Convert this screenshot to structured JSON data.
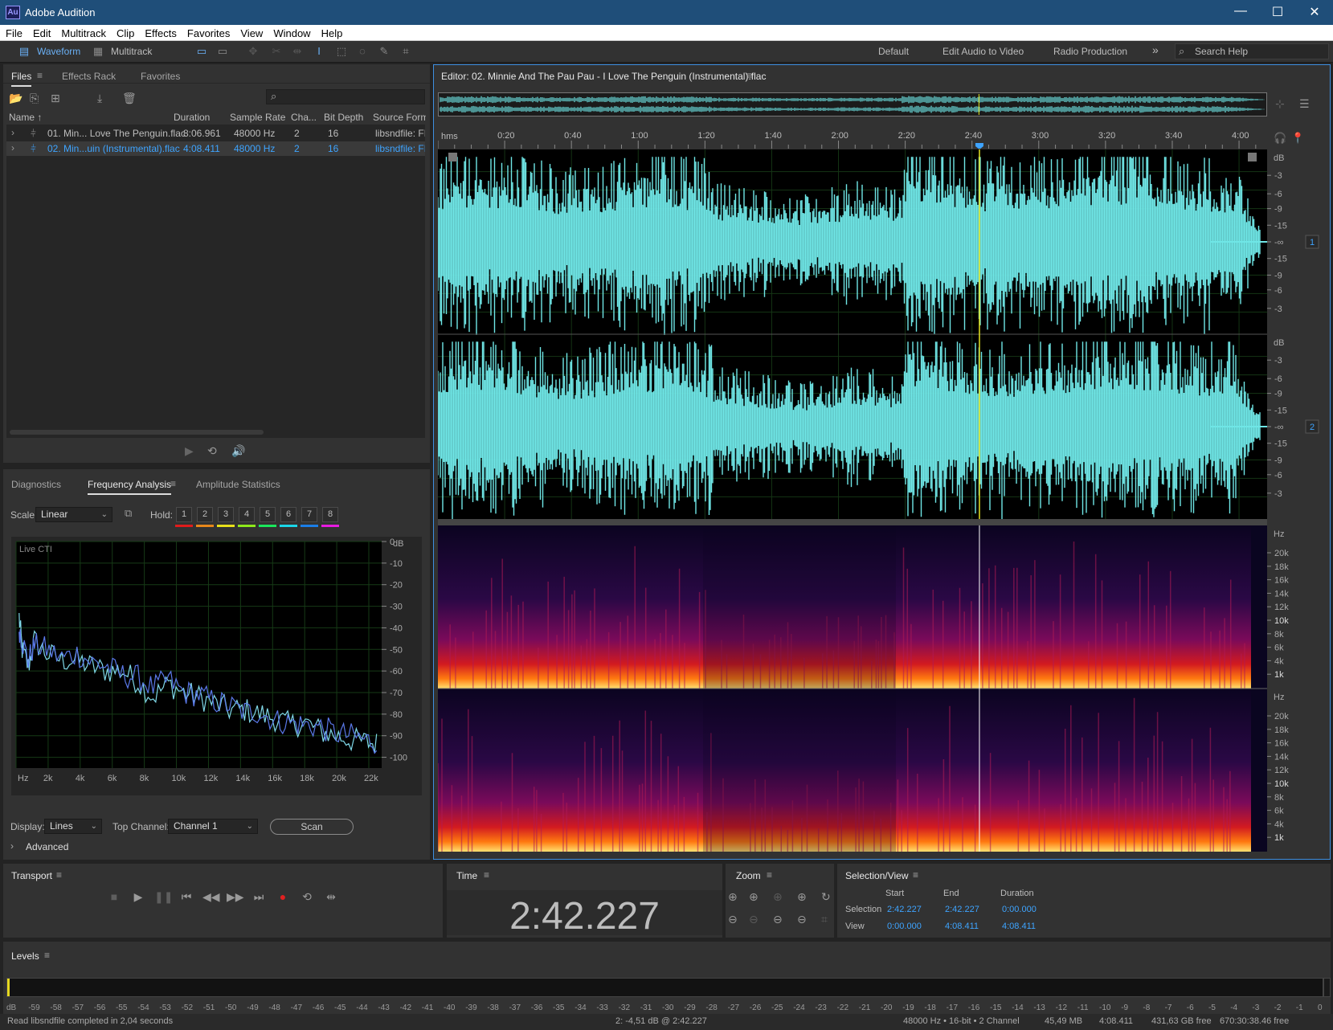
{
  "window": {
    "title": "Adobe Audition",
    "logo": "Au",
    "minimize": "—",
    "maximize": "☐",
    "close": "✕"
  },
  "menu": [
    "File",
    "Edit",
    "Multitrack",
    "Clip",
    "Effects",
    "Favorites",
    "View",
    "Window",
    "Help"
  ],
  "toolbar": {
    "waveform": "Waveform",
    "multitrack": "Multitrack",
    "workspaces": [
      "Default",
      "Edit Audio to Video",
      "Radio Production"
    ],
    "more": "»",
    "search_placeholder": "Search Help"
  },
  "files_panel": {
    "tabs": [
      "Files",
      "Effects Rack",
      "Favorites"
    ],
    "columns": [
      "Name ↑",
      "Duration",
      "Sample Rate",
      "Cha...",
      "Bit Depth",
      "Source Form"
    ],
    "rows": [
      {
        "name": "01. Min... Love The Penguin.flac",
        "duration": "8:06.961",
        "rate": "48000 Hz",
        "ch": "2",
        "depth": "16",
        "src": "libsndfile: FL",
        "selected": false
      },
      {
        "name": "02. Min...uin (Instrumental).flac",
        "duration": "4:08.411",
        "rate": "48000 Hz",
        "ch": "2",
        "depth": "16",
        "src": "libsndfile: FL",
        "selected": true
      }
    ]
  },
  "analysis_panel": {
    "tabs": [
      "Diagnostics",
      "Frequency Analysis",
      "Amplitude Statistics"
    ],
    "scale_label": "Scale:",
    "scale_value": "Linear",
    "hold_label": "Hold:",
    "hold": [
      "1",
      "2",
      "3",
      "4",
      "5",
      "6",
      "7",
      "8"
    ],
    "hold_colors": [
      "#e01b1b",
      "#e8871a",
      "#e8e01a",
      "#8ee81a",
      "#1ae85c",
      "#1ad6e8",
      "#1a7ee8",
      "#e81ae0"
    ],
    "chart_caption": "Live CTI",
    "display_label": "Display:",
    "display_value": "Lines",
    "top_channel_label": "Top Channel:",
    "top_channel_value": "Channel 1",
    "scan": "Scan",
    "advanced": "Advanced"
  },
  "chart_data": {
    "type": "line",
    "xlabel": "Hz",
    "ylabel": "dB",
    "x_ticks": [
      "Hz",
      "2k",
      "4k",
      "6k",
      "8k",
      "10k",
      "12k",
      "14k",
      "16k",
      "18k",
      "20k",
      "22k"
    ],
    "y_ticks": [
      "0",
      "-10",
      "-20",
      "-30",
      "-40",
      "-50",
      "-60",
      "-70",
      "-80",
      "-90",
      "-100"
    ],
    "xlim": [
      0,
      24000
    ],
    "ylim": [
      -105,
      0
    ],
    "series": [
      {
        "color": "#7fd8e8",
        "x": [
          200,
          400,
          800,
          1200,
          2000,
          3000,
          4000,
          5000,
          6000,
          7000,
          8000,
          9000,
          10000,
          11000,
          12000,
          13000,
          14000,
          15000,
          16000,
          17000,
          18000,
          19000,
          20000,
          21000,
          22000,
          23000,
          23800
        ],
        "y": [
          -35,
          -50,
          -58,
          -46,
          -52,
          -55,
          -55,
          -58,
          -60,
          -60,
          -65,
          -72,
          -66,
          -70,
          -72,
          -75,
          -78,
          -78,
          -80,
          -82,
          -85,
          -84,
          -88,
          -90,
          -92,
          -93,
          -94
        ]
      },
      {
        "color": "#5a78e8",
        "x": [
          200,
          400,
          800,
          1200,
          2000,
          3000,
          4000,
          5000,
          6000,
          7000,
          8000,
          9000,
          10000,
          11000,
          12000,
          13000,
          14000,
          15000,
          16000,
          17000,
          18000,
          19000,
          20000,
          21000,
          22000,
          23000,
          23800
        ],
        "y": [
          -40,
          -46,
          -55,
          -48,
          -50,
          -54,
          -52,
          -56,
          -58,
          -62,
          -63,
          -68,
          -64,
          -70,
          -71,
          -74,
          -76,
          -79,
          -79,
          -83,
          -84,
          -85,
          -86,
          -89,
          -90,
          -92,
          -93
        ]
      }
    ]
  },
  "editor": {
    "title": "Editor: 02. Minnie And The Pau Pau - I Love The Penguin (Instrumental).flac",
    "ruler_unit": "hms",
    "ruler_ticks": [
      "0:20",
      "0:40",
      "1:00",
      "1:20",
      "1:40",
      "2:00",
      "2:20",
      "2:40",
      "3:00",
      "3:20",
      "3:40",
      "4:00"
    ],
    "db_label": "dB",
    "db_ticks_ch1": [
      "-3",
      "-6",
      "-9",
      "-15",
      "-∞",
      "-15",
      "-9",
      "-6",
      "-3"
    ],
    "db_ticks_ch2": [
      "-3",
      "-6",
      "-9",
      "-15",
      "-∞",
      "-15",
      "-9",
      "-6",
      "-3"
    ],
    "channel_badges": [
      "1",
      "2"
    ],
    "hz_label": "Hz",
    "hz_ticks": [
      "20k",
      "18k",
      "16k",
      "14k",
      "12k",
      "10k",
      "8k",
      "6k",
      "4k",
      "1k"
    ],
    "playhead_time": 162.227,
    "duration_seconds": 248.411,
    "waveform_color": "#6fe6e6",
    "playhead_color": "#e5e520"
  },
  "transport": {
    "title": "Transport",
    "buttons": [
      "stop",
      "play",
      "pause",
      "to-start",
      "rewind",
      "fast-forward",
      "to-end",
      "record",
      "loop",
      "skip-selection"
    ]
  },
  "time": {
    "title": "Time",
    "value": "2:42.227"
  },
  "zoom": {
    "title": "Zoom"
  },
  "selection_view": {
    "title": "Selection/View",
    "headers": [
      "Start",
      "End",
      "Duration"
    ],
    "rows": [
      {
        "label": "Selection",
        "start": "2:42.227",
        "end": "2:42.227",
        "duration": "0:00.000"
      },
      {
        "label": "View",
        "start": "0:00.000",
        "end": "4:08.411",
        "duration": "4:08.411"
      }
    ]
  },
  "levels": {
    "title": "Levels",
    "ticks": [
      "dB",
      "-59",
      "-58",
      "-57",
      "-56",
      "-55",
      "-54",
      "-53",
      "-52",
      "-51",
      "-50",
      "-49",
      "-48",
      "-47",
      "-46",
      "-45",
      "-44",
      "-43",
      "-42",
      "-41",
      "-40",
      "-39",
      "-38",
      "-37",
      "-36",
      "-35",
      "-34",
      "-33",
      "-32",
      "-31",
      "-30",
      "-29",
      "-28",
      "-27",
      "-26",
      "-25",
      "-24",
      "-23",
      "-22",
      "-21",
      "-20",
      "-19",
      "-18",
      "-17",
      "-16",
      "-15",
      "-14",
      "-13",
      "-12",
      "-11",
      "-10",
      "-9",
      "-8",
      "-7",
      "-6",
      "-5",
      "-4",
      "-3",
      "-2",
      "-1",
      "0"
    ]
  },
  "status": {
    "left": "Read libsndfile completed in 2,04 seconds",
    "cursor": "2: -4,51 dB @ 2:42.227",
    "format": "48000 Hz • 16-bit • 2 Channel",
    "size": "45,49 MB",
    "duration": "4:08.411",
    "free": "431,63 GB free",
    "free_time": "670:30:38.46 free"
  }
}
